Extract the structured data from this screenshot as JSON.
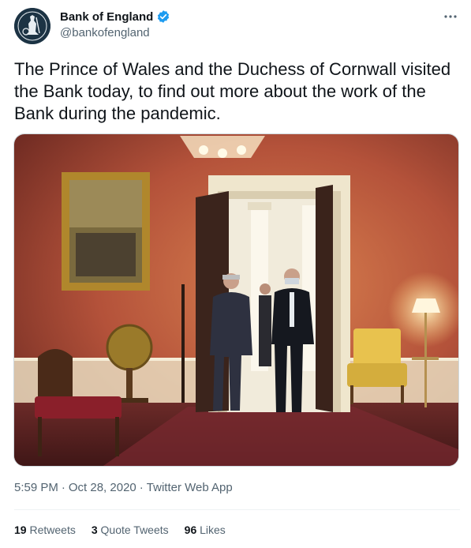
{
  "account": {
    "display_name": "Bank of England",
    "handle": "@bankofengland",
    "verified_icon": "verified-badge-icon",
    "avatar_icon": "britannia-logo-icon"
  },
  "tweet": {
    "text": "The Prince of Wales and the Duchess of Cornwall visited the Bank today, to find out more about the work of the Bank during the pandemic."
  },
  "meta": {
    "time": "5:59 PM",
    "separator": "·",
    "date": "Oct 28, 2020",
    "source": "Twitter Web App"
  },
  "stats": {
    "retweets_count": "19",
    "retweets_label": "Retweets",
    "quotes_count": "3",
    "quotes_label": "Quote Tweets",
    "likes_count": "96",
    "likes_label": "Likes"
  },
  "more_icon": "more-options-icon",
  "colors": {
    "verified": "#1d9bf0",
    "secondary_text": "#536471",
    "room_wall": "#b8553a"
  }
}
